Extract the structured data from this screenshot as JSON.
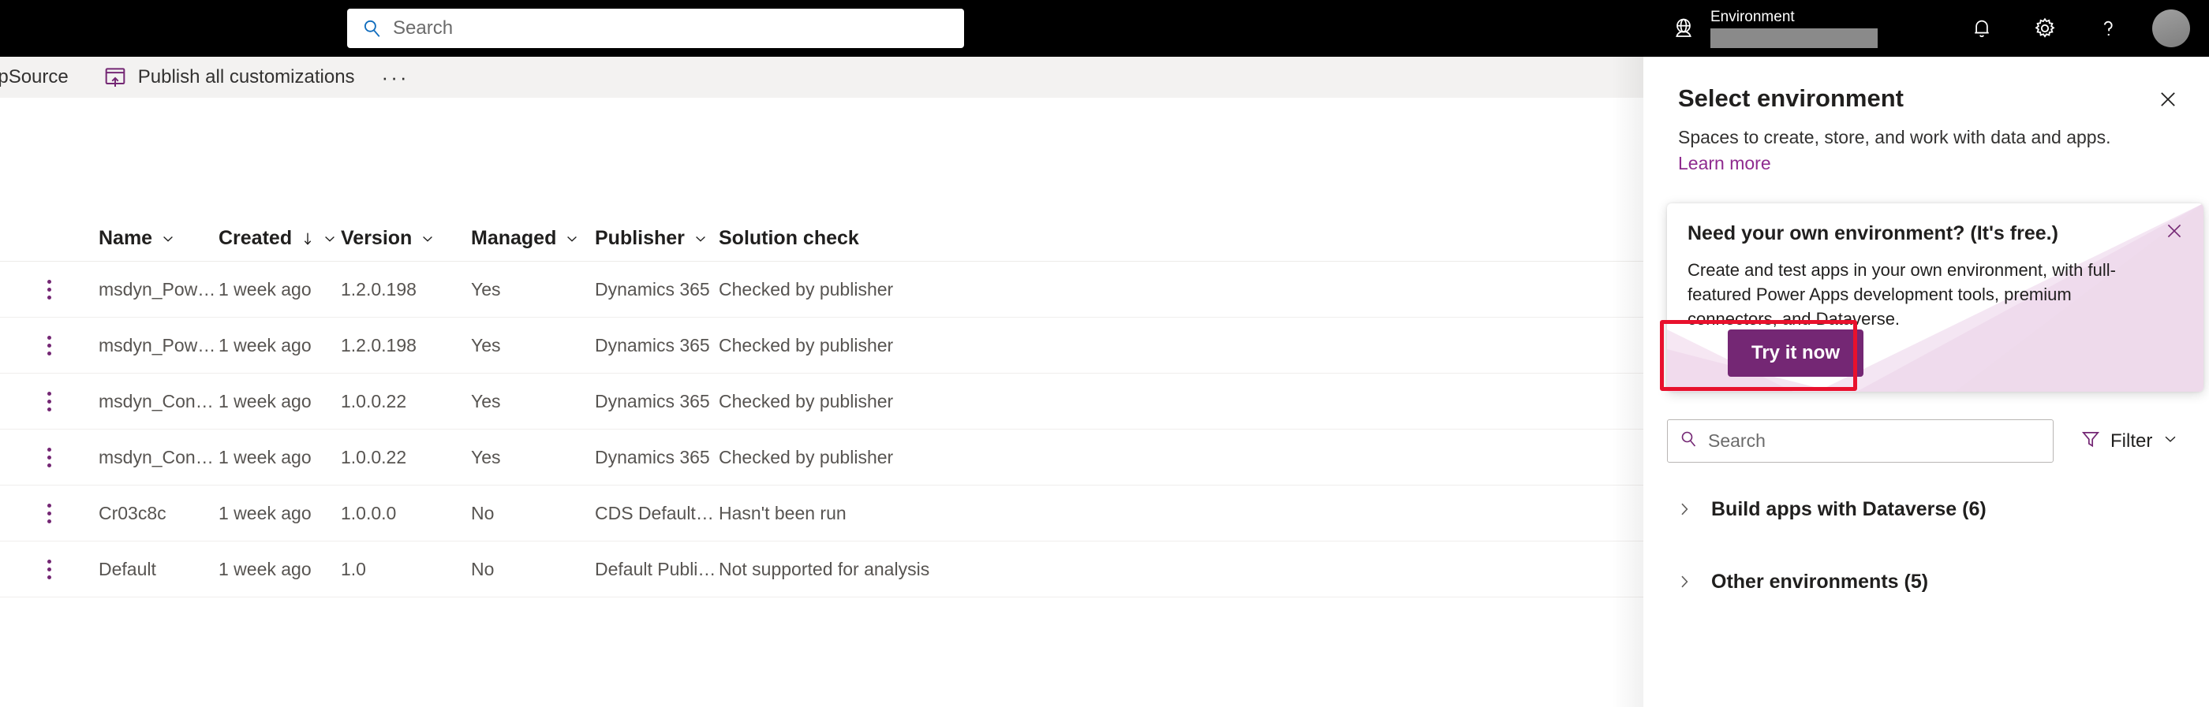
{
  "topbar": {
    "search_placeholder": "Search",
    "search_icon": "search-icon",
    "globe_icon": "globe-environment-icon",
    "environment_label": "Environment",
    "environment_value": "",
    "notifications_icon": "bell-icon",
    "settings_icon": "gear-icon",
    "help_icon": "question-mark-icon",
    "avatar_icon": "user-avatar"
  },
  "commandbar": {
    "appsource_label": "AppSource",
    "publish_label": "Publish all customizations",
    "publish_icon": "publish-icon",
    "overflow_label": "···"
  },
  "grid": {
    "columns": [
      {
        "label": "Name",
        "sorted": false
      },
      {
        "label": "Created",
        "sorted": true
      },
      {
        "label": "Version",
        "sorted": false
      },
      {
        "label": "Managed",
        "sorted": false
      },
      {
        "label": "Publisher",
        "sorted": false
      },
      {
        "label": "Solution check",
        "sorted": false
      }
    ],
    "sort_arrow": "↓",
    "rows": [
      {
        "name": "msdyn_PowerAppsC...",
        "created": "1 week ago",
        "version": "1.2.0.198",
        "managed": "Yes",
        "publisher": "Dynamics 365",
        "solution_check": "Checked by publisher"
      },
      {
        "name": "msdyn_PowerAppsC...",
        "created": "1 week ago",
        "version": "1.2.0.198",
        "managed": "Yes",
        "publisher": "Dynamics 365",
        "solution_check": "Checked by publisher"
      },
      {
        "name": "msdyn_ContextualH...",
        "created": "1 week ago",
        "version": "1.0.0.22",
        "managed": "Yes",
        "publisher": "Dynamics 365",
        "solution_check": "Checked by publisher"
      },
      {
        "name": "msdyn_ContextualH...",
        "created": "1 week ago",
        "version": "1.0.0.22",
        "managed": "Yes",
        "publisher": "Dynamics 365",
        "solution_check": "Checked by publisher"
      },
      {
        "name": "Cr03c8c",
        "created": "1 week ago",
        "version": "1.0.0.0",
        "managed": "No",
        "publisher": "CDS Default Publisher",
        "solution_check": "Hasn't been run"
      },
      {
        "name": "Default",
        "created": "1 week ago",
        "version": "1.0",
        "managed": "No",
        "publisher": "Default Publisher for...",
        "solution_check": "Not supported for analysis"
      }
    ]
  },
  "panel": {
    "title": "Select environment",
    "subtitle": "Spaces to create, store, and work with data and apps.",
    "learn_more": "Learn more",
    "close_icon": "close-icon",
    "search_placeholder": "Search",
    "search_icon": "search-icon",
    "filter_label": "Filter",
    "filter_icon": "filter-funnel-icon",
    "filter_chevron_icon": "chevron-down-icon",
    "groups": [
      {
        "label": "Build apps with Dataverse (6)",
        "chevron_icon": "chevron-right-icon"
      },
      {
        "label": "Other environments (5)",
        "chevron_icon": "chevron-right-icon"
      }
    ]
  },
  "callout": {
    "title": "Need your own environment? (It's free.)",
    "body": "Create and test apps in your own environment, with full-featured Power Apps development tools, premium connectors, and Dataverse.",
    "button_label": "Try it now",
    "close_icon": "close-icon"
  },
  "colors": {
    "brand_purple": "#742774",
    "link_purple": "#8f2b8f",
    "topbar_black": "#000000",
    "cmdbar_gray": "#f3f2f1",
    "annotation_red": "#e8112d",
    "callout_pink": "#eed4ea"
  }
}
